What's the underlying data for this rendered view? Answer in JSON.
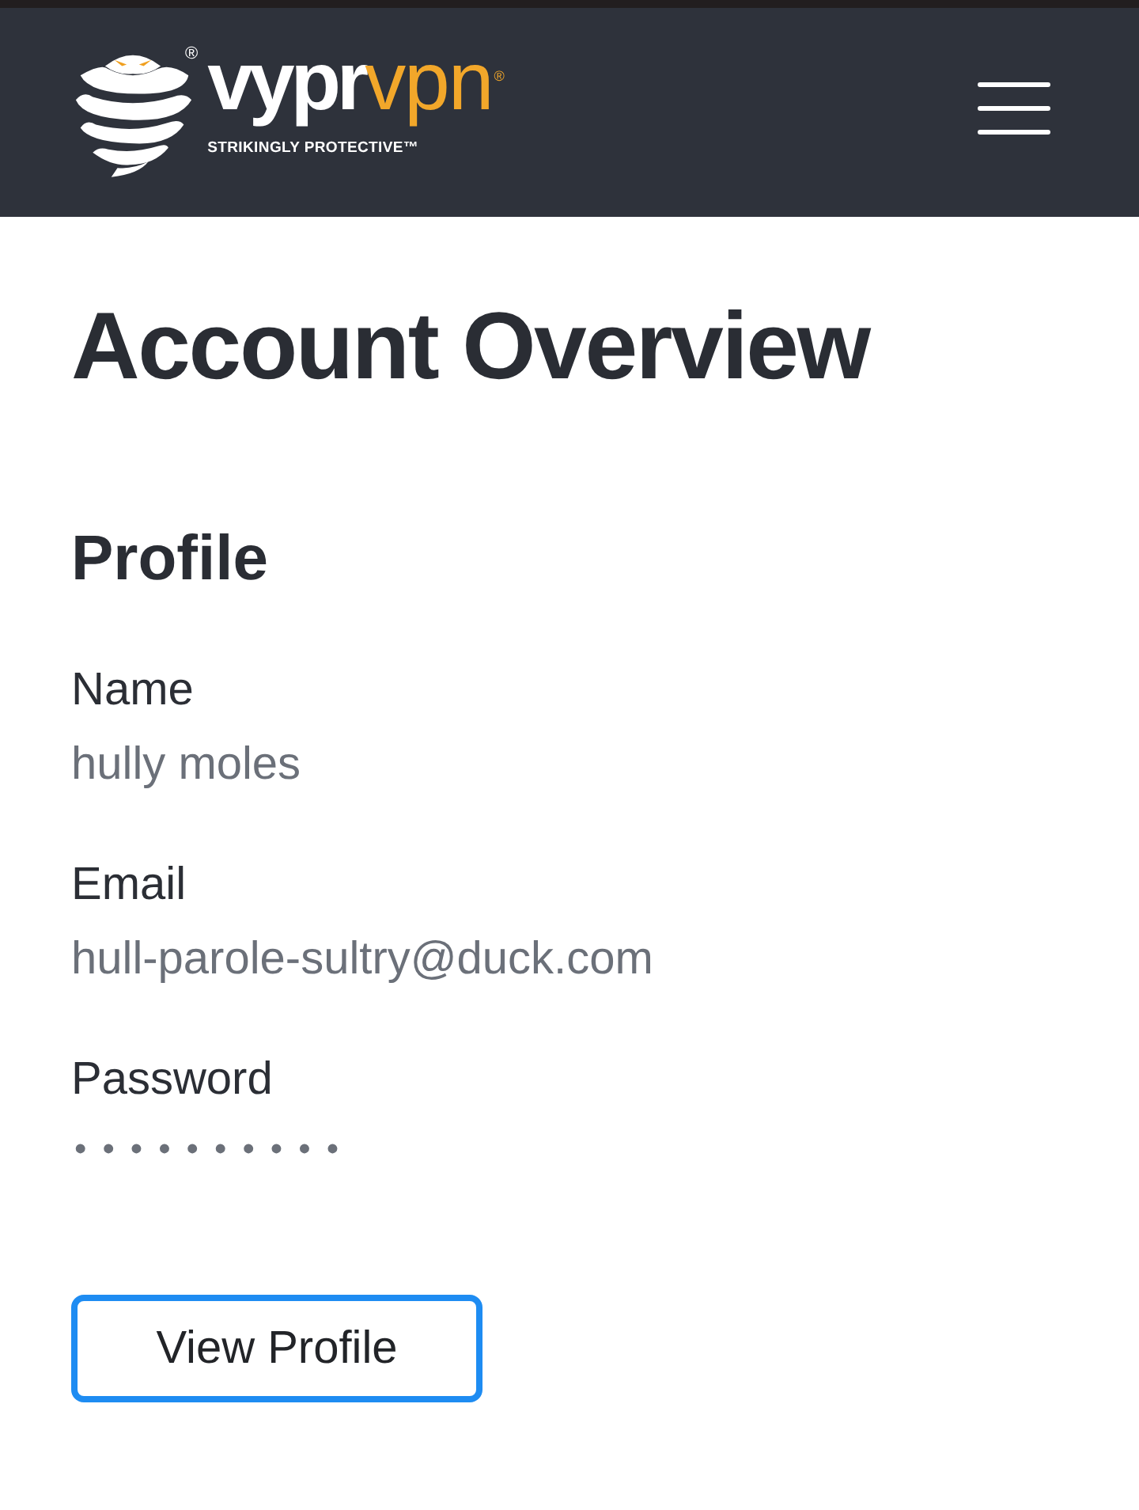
{
  "header": {
    "logo": {
      "symbol_mark": "®",
      "wordmark_primary": "vypr",
      "wordmark_accent": "vpn",
      "wordmark_mark": "®",
      "tagline": "STRIKINGLY PROTECTIVE™"
    }
  },
  "page": {
    "title": "Account Overview",
    "section": {
      "title": "Profile",
      "fields": [
        {
          "label": "Name",
          "value": "hully moles",
          "kind": "text"
        },
        {
          "label": "Email",
          "value": "hull-parole-sultry@duck.com",
          "kind": "text"
        },
        {
          "label": "Password",
          "value": "••••••••••",
          "kind": "masked"
        }
      ],
      "button": "View Profile"
    }
  }
}
